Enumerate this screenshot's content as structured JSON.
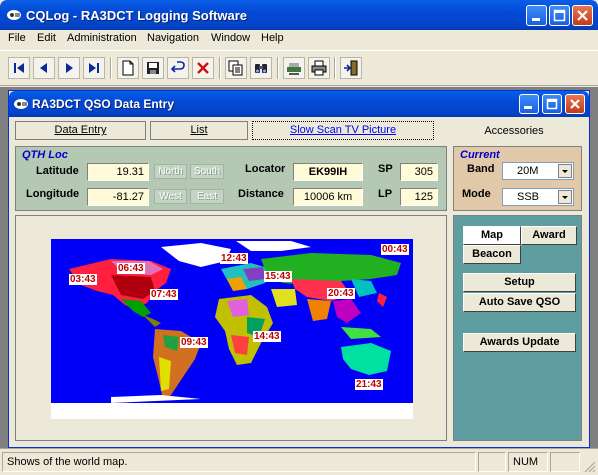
{
  "app": {
    "title": "CQLog - RA3DCT Logging Software"
  },
  "menu": {
    "items": [
      "File",
      "Edit",
      "Administration",
      "Navigation",
      "Window",
      "Help"
    ]
  },
  "toolbar": {
    "buttons": [
      "first-record",
      "previous-record",
      "next-record",
      "last-record",
      "new",
      "save",
      "undo",
      "delete",
      "copy",
      "find",
      "network",
      "print",
      "exit"
    ]
  },
  "child": {
    "title": "RA3DCT QSO Data Entry",
    "tabs": [
      "Data Entry",
      "List",
      "Slow Scan TV Picture",
      "Accessories"
    ]
  },
  "qth": {
    "group_label": "QTH Loc",
    "latitude_label": "Latitude",
    "latitude": "19.31",
    "longitude_label": "Longitude",
    "longitude": "-81.27",
    "north": "North",
    "south": "South",
    "west": "West",
    "east": "East",
    "locator_label": "Locator",
    "locator": "EK99IH",
    "distance_label": "Distance",
    "distance": "10006 km",
    "sp_label": "SP",
    "sp": "305",
    "lp_label": "LP",
    "lp": "125"
  },
  "current": {
    "group_label": "Current",
    "band_label": "Band",
    "band": "20M",
    "mode_label": "Mode",
    "mode": "SSB"
  },
  "map": {
    "times": [
      "00:43",
      "03:43",
      "06:43",
      "07:43",
      "09:43",
      "12:43",
      "14:43",
      "15:43",
      "20:43",
      "21:43"
    ]
  },
  "right": {
    "tabs": [
      "Map",
      "Award",
      "Beacon"
    ],
    "setup": "Setup",
    "autosave": "Auto Save QSO",
    "awards_update": "Awards Update"
  },
  "status": {
    "text": "Shows of the world map.",
    "num": "NUM"
  },
  "colors": {
    "title_blue": "#0449d6",
    "ocean": "#0000f8",
    "qth_bg": "#b4c8b4",
    "current_bg": "#e0c8a8",
    "right_bg": "#5f9ea0",
    "field_yellow": "#fffbd8",
    "time_red": "#c00000"
  }
}
